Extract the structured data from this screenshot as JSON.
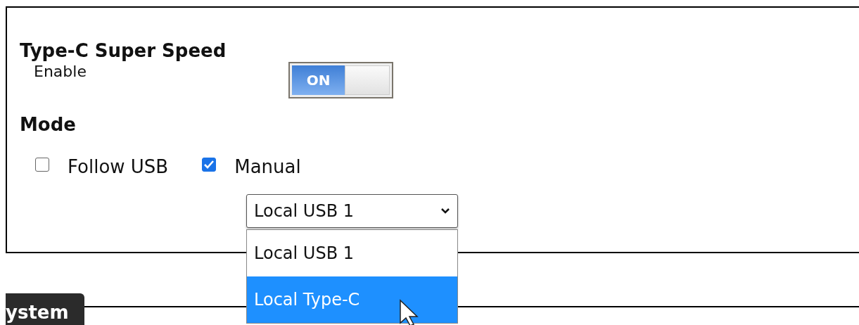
{
  "section": {
    "title": "Type-C Super Speed",
    "enable_label": "Enable",
    "toggle": {
      "label": "ON",
      "on": true
    }
  },
  "mode": {
    "title": "Mode",
    "options": [
      {
        "label": "Follow USB",
        "checked": false
      },
      {
        "label": "Manual",
        "checked": true
      }
    ],
    "select": {
      "value": "Local USB 1",
      "expanded": true,
      "options": [
        {
          "label": "Local USB 1",
          "highlighted": false
        },
        {
          "label": "Local Type-C",
          "highlighted": true
        }
      ]
    }
  },
  "next_tab": {
    "label": "ystem"
  }
}
